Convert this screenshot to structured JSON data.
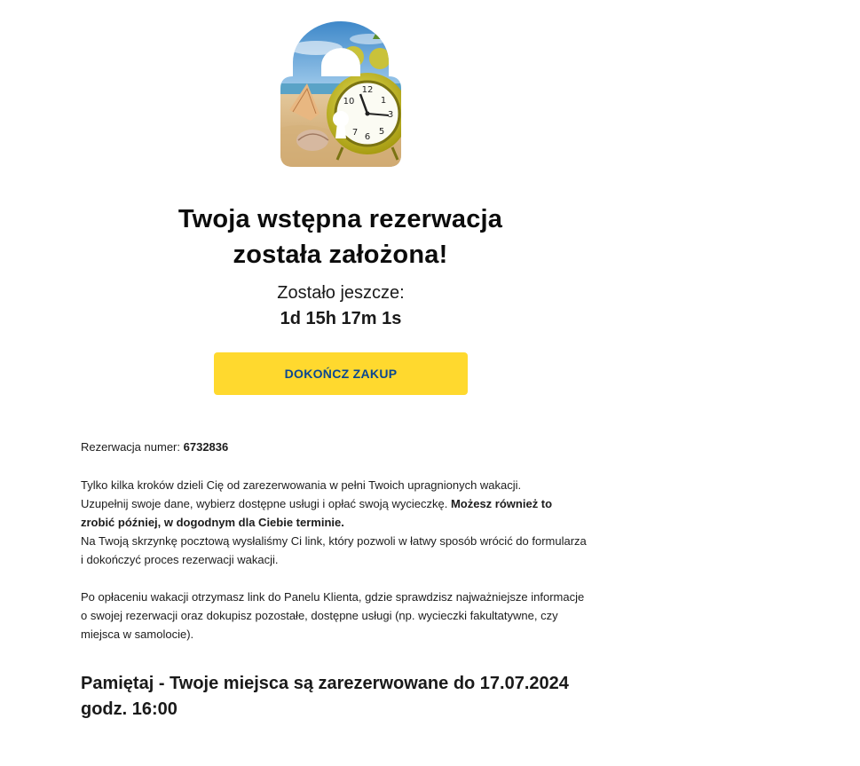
{
  "header": {
    "hero_image": "lock-with-alarm-clock-on-beach",
    "title_line1": "Twoja wstępna rezerwacja",
    "title_line2": "została założona!"
  },
  "countdown": {
    "label": "Zostało jeszcze:",
    "value": "1d 15h 17m 1s"
  },
  "cta": {
    "label": "DOKOŃCZ ZAKUP",
    "bg_color": "#ffd92e",
    "text_color": "#0b4790"
  },
  "reservation": {
    "number_label": "Rezerwacja numer:",
    "number": "6732836"
  },
  "info": {
    "p1_line1": "Tylko kilka kroków dzieli Cię od zarezerwowania w pełni Twoich upragnionych wakacji.",
    "p1_line2": "Uzupełnij swoje dane, wybierz dostępne usługi i opłać swoją wycieczkę.",
    "p1_bold": "Możesz również to zrobić później, w dogodnym dla Ciebie terminie.",
    "p1_line3": "Na Twoją skrzynkę pocztową wysłaliśmy Ci link, który pozwoli w łatwy sposób wrócić do formularza i dokończyć proces rezerwacji wakacji.",
    "p2": "Po opłaceniu wakacji otrzymasz link do Panelu Klienta, gdzie sprawdzisz najważniejsze informacje o swojej rezerwacji oraz dokupisz pozostałe, dostępne usługi (np. wycieczki fakultatywne, czy miejsca w samolocie)."
  },
  "reminder": {
    "text": "Pamiętaj - Twoje miejsca są zarezerwowane do 17.07.2024 godz. 16:00"
  }
}
